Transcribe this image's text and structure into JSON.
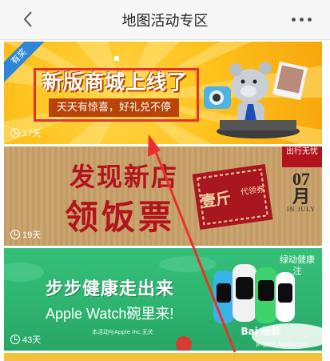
{
  "header": {
    "title": "地图活动专区",
    "back_icon": "chevron-left-icon",
    "more_icon": "more-dots-icon"
  },
  "banners": [
    {
      "ribbon": "有奖",
      "headline": "新版商城上线了",
      "subline": "天天有惊喜，好礼兑不停",
      "days": "17天"
    },
    {
      "headline_line1": "发现新店",
      "headline_line2": "领饭票",
      "ticket_text": "壹斤",
      "ticket_text_2": "代领券",
      "date_number": "07月",
      "date_month": "IN JULY",
      "corner": "出行无忧",
      "days": "19天"
    },
    {
      "headline": "步步健康走出来",
      "subline": "Apple Watch碗里来!",
      "fine_print": "本活动与Apple Inc.无关",
      "corner": "绿动健康注",
      "days": "43天"
    }
  ],
  "watermark": {
    "logo": "Bai 经验",
    "url": "jingyan.baidu.com"
  },
  "colors": {
    "highlight_box": "#e8312e",
    "arrow": "#e8312e",
    "banner1_bg": "#ffc21c",
    "banner2_bg": "#c9a16a",
    "banner3_bg": "#2eb46f"
  }
}
